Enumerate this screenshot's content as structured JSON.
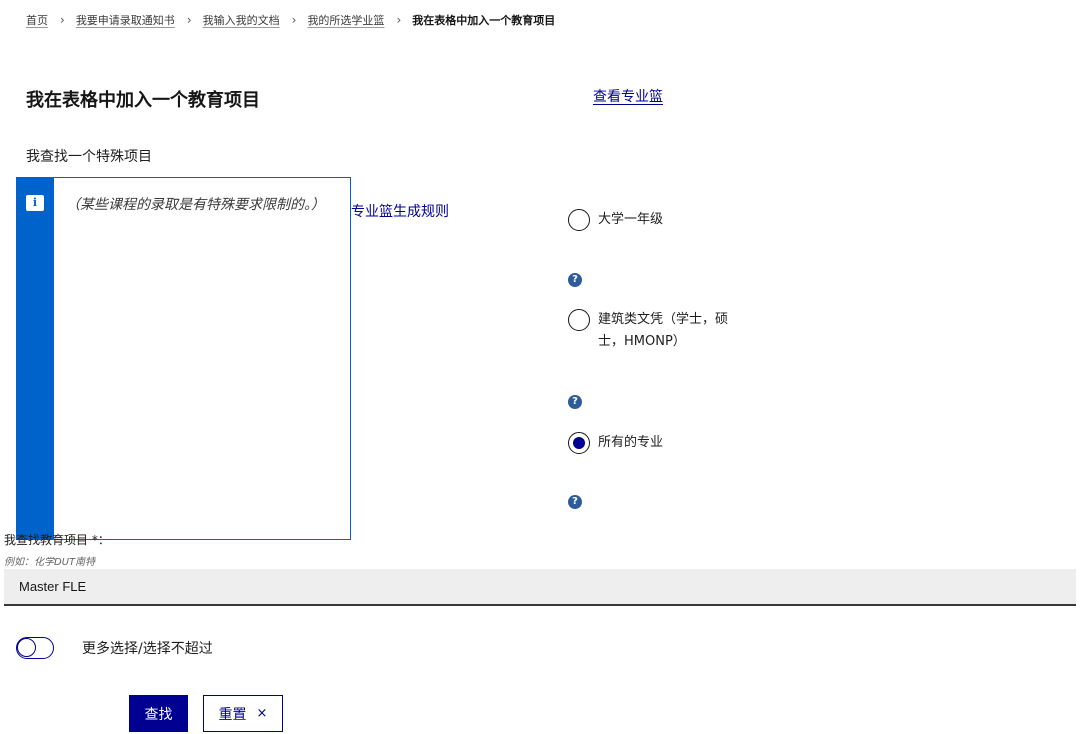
{
  "breadcrumb": {
    "items": [
      "首页",
      "我要申请录取通知书",
      "我输入我的文档",
      "我的所选学业篮"
    ],
    "current": "我在表格中加入一个教育项目",
    "separator": "›"
  },
  "page_title": "我在表格中加入一个教育项目",
  "basket_link": "查看专业篮",
  "section_label": "我查找一个特殊项目",
  "info_box": {
    "icon_label": "i",
    "text": "（某些课程的录取是有特殊要求限制的。）"
  },
  "rules_link": "专业篮生成规则",
  "radio_options": [
    {
      "label": "大学一年级",
      "checked": false
    },
    {
      "label": "建筑类文凭（学士，硕士，HMONP）",
      "checked": false
    },
    {
      "label": "所有的专业",
      "checked": true
    }
  ],
  "help_icon_label": "?",
  "program_field": {
    "label": "我查找教育项目 *：",
    "hint": "例如：化学DUT南特",
    "value": "Master FLE"
  },
  "toggle": {
    "label": "更多选择/选择不超过",
    "on": false
  },
  "buttons": {
    "search": "查找",
    "reset": "重置",
    "reset_icon": "×"
  },
  "colors": {
    "accent": "#000091",
    "info": "#0063cb",
    "help": "#2e5b9a"
  }
}
